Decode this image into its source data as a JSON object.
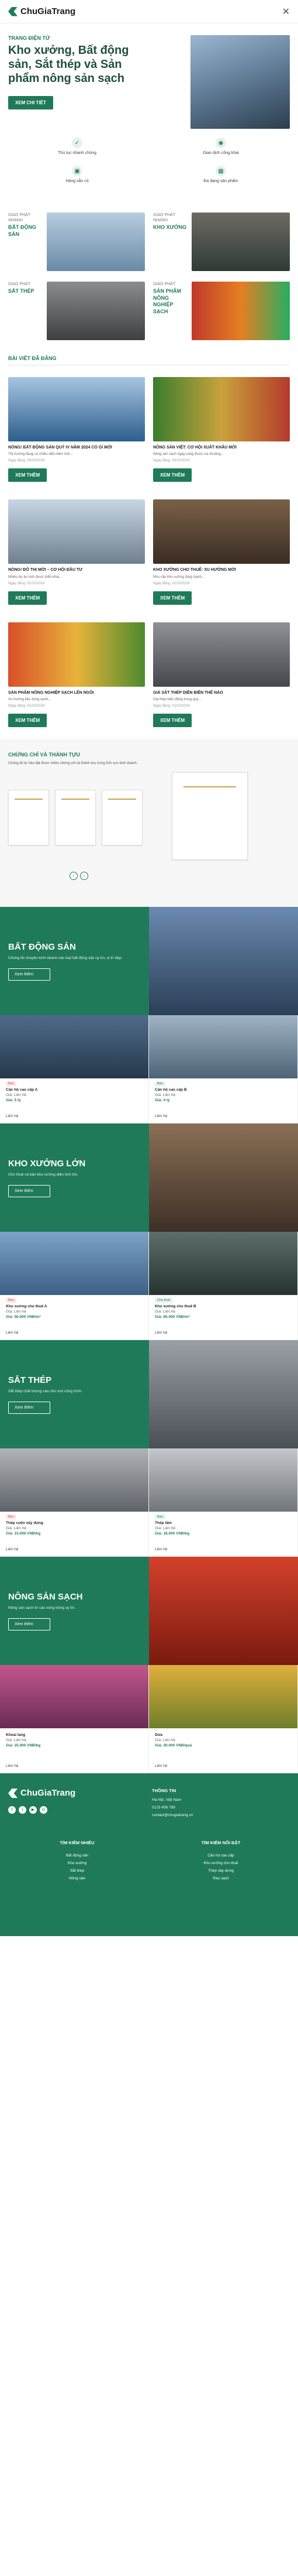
{
  "header": {
    "brand": "ChuGiaTrang"
  },
  "hero": {
    "tag": "TRANG ĐIỆN TỬ",
    "title": "Kho xưởng, Bất động sản, Sắt thép và Sản phẩm nông sản sạch",
    "cta": "XEM CHI TIẾT"
  },
  "features": [
    "Thủ tục nhanh chóng",
    "Giao dịch công khai",
    "Hàng sẵn có",
    "Đa dạng sản phẩm"
  ],
  "categories": [
    {
      "label": "GIAO PHÁT NHANH",
      "title": "BẤT ĐỘNG SẢN"
    },
    {
      "label": "GIAO PHÁT NHANH",
      "title": "KHO XƯỞNG"
    },
    {
      "label": "GIAO PHÁT",
      "title": "SẮT THÉP"
    },
    {
      "label": "GIAO PHÁT",
      "title": "SẢN PHẨM NÔNG NGHIỆP SẠCH"
    }
  ],
  "news_title": "BÀI VIẾT ĐÃ ĐĂNG",
  "news": [
    {
      "title": "NÓNG! BẤT ĐỘNG SẢN QUÝ IV NĂM 2024 CÓ GÌ MỚI",
      "desc": "Thị trường đang có nhiều diễn biến mới...",
      "date": "Ngày đăng: 03/10/2024",
      "cta": "XEM THÊM"
    },
    {
      "title": "NÔNG SẢN VIỆT: CƠ HỘI XUẤT KHẨU MỚI",
      "desc": "Nông sản sạch ngày càng được ưa chuộng...",
      "date": "Ngày đăng: 03/10/2024",
      "cta": "XEM THÊM"
    },
    {
      "title": "NÓNG! ĐÔ THỊ MỚI – CƠ HỘI ĐẦU TƯ",
      "desc": "Nhiều dự án mới được triển khai...",
      "date": "Ngày đăng: 02/10/2024",
      "cta": "XEM THÊM"
    },
    {
      "title": "KHO XƯỞNG CHO THUÊ: XU HƯỚNG MỚI",
      "desc": "Nhu cầu kho xưởng tăng mạnh...",
      "date": "Ngày đăng: 02/10/2024",
      "cta": "XEM THÊM"
    },
    {
      "title": "SẢN PHẨM NÔNG NGHIỆP SẠCH LÊN NGÔI",
      "desc": "Xu hướng tiêu dùng xanh...",
      "date": "Ngày đăng: 01/10/2024",
      "cta": "XEM THÊM"
    },
    {
      "title": "GIÁ SẮT THÉP DIỄN BIẾN THẾ NÀO",
      "desc": "Giá thép biến động trong quý...",
      "date": "Ngày đăng: 01/10/2024",
      "cta": "XEM THÊM"
    }
  ],
  "certs": {
    "title": "CHỨNG CHỈ VÀ THÀNH TỰU",
    "desc": "Chúng tôi tự hào đạt được nhiều chứng chỉ và thành tựu trong lĩnh vực kinh doanh."
  },
  "sections": [
    {
      "title": "BẤT ĐỘNG SẢN",
      "desc": "Chúng tôi chuyên kinh doanh các loại bất động sản uy tín, vị trí đẹp.",
      "cta": "Xem thêm",
      "products": [
        {
          "badge": "Bán",
          "name": "Căn hộ cao cấp A",
          "meta": "Giá: Liên hệ",
          "price": "Giá: 5 tỷ"
        },
        {
          "badge": "Bán",
          "name": "Căn hộ cao cấp B",
          "meta": "Giá: Liên hệ",
          "price": "Giá: 4 tỷ"
        },
        {
          "badge": "Bán",
          "name": "Căn hộ cao cấp C",
          "meta": "Giá: Liên hệ",
          "price": "Giá: 3 tỷ"
        }
      ]
    },
    {
      "title": "KHO XƯỞNG LỚN",
      "desc": "Cho thuê và bán kho xưởng diện tích lớn.",
      "cta": "Xem thêm",
      "products": [
        {
          "badge": "Bán",
          "name": "Kho xưởng cho thuê A",
          "meta": "Giá: Liên hệ",
          "price": "Giá: 50.000 VNĐ/m²"
        },
        {
          "badge": "Cho thuê",
          "name": "Kho xưởng cho thuê B",
          "meta": "Giá: Liên hệ",
          "price": "Giá: 60.000 VNĐ/m²"
        },
        {
          "badge": "Cho thuê",
          "name": "Kho xưởng cho thuê C",
          "meta": "Giá: Liên hệ",
          "price": "Giá: 55.000 VNĐ/m²"
        }
      ]
    },
    {
      "title": "SẮT THÉP",
      "desc": "Sắt thép chất lượng cao cho mọi công trình.",
      "cta": "Xem thêm",
      "products": [
        {
          "badge": "Bán",
          "name": "Thép cuộn xây dựng",
          "meta": "Giá: Liên hệ",
          "price": "Giá: 15.000 VNĐ/kg"
        },
        {
          "badge": "Bán",
          "name": "Thép tấm",
          "meta": "Giá: Liên hệ",
          "price": "Giá: 18.000 VNĐ/kg"
        },
        {
          "badge": "Bán",
          "name": "Thép ống",
          "meta": "Giá: Liên hệ",
          "price": "Giá: 17.000 VNĐ/kg"
        }
      ]
    },
    {
      "title": "NÔNG SẢN SẠCH",
      "desc": "Nông sản sạch từ các vùng trồng uy tín.",
      "cta": "Xem thêm",
      "products": [
        {
          "badge": "",
          "name": "Cà chua",
          "meta": "Giá: Liên hệ",
          "price": "Giá: 30.000 VNĐ/kg"
        },
        {
          "badge": "",
          "name": "Khoai lang",
          "meta": "Giá: Liên hệ",
          "price": "Giá: 25.000 VNĐ/kg"
        },
        {
          "badge": "",
          "name": "Dứa",
          "meta": "Giá: Liên hệ",
          "price": "Giá: 20.000 VNĐ/quả"
        }
      ]
    }
  ],
  "more_label": "Liên hệ",
  "footer": {
    "brand": "ChuGiaTrang",
    "contact_title": "THÔNG TIN",
    "phone": "0123 456 789",
    "email": "contact@chugiatrang.vn",
    "address": "Hà Nội, Việt Nam",
    "links_title": "TÌM KIẾM NHIỀU",
    "links": [
      "Bất động sản",
      "Kho xưởng",
      "Sắt thép",
      "Nông sản"
    ],
    "right_title": "TÌM KIẾM NỔI BẬT",
    "right_links": [
      "Căn hộ cao cấp",
      "Kho xưởng cho thuê",
      "Thép xây dựng",
      "Rau sạch"
    ]
  }
}
